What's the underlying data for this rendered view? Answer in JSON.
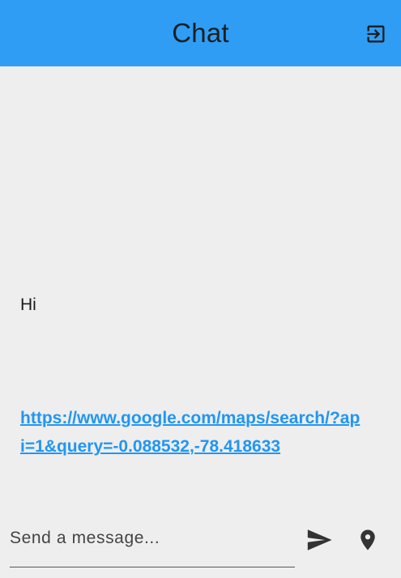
{
  "appbar": {
    "title": "Chat",
    "logout_icon": "logout-icon",
    "background_color": "#2f9df4"
  },
  "messages": [
    {
      "type": "text",
      "text": "Hi"
    },
    {
      "type": "link",
      "text": "https://www.google.com/maps/search/?api=1&query=-0.088532,-78.418633"
    }
  ],
  "composer": {
    "placeholder": "Send a message...",
    "value": "",
    "send_icon": "send-icon",
    "location_icon": "location-pin-icon"
  },
  "colors": {
    "background": "#eeeeee",
    "link": "#2196f3",
    "icon": "#333333"
  }
}
